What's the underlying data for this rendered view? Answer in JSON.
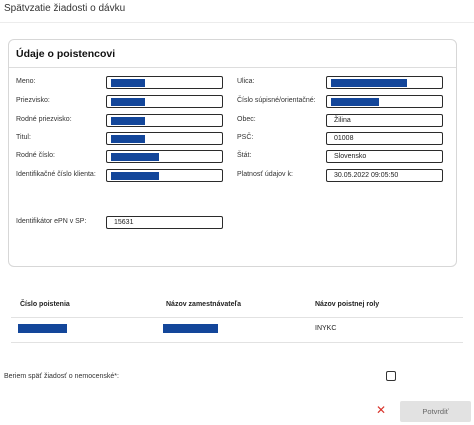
{
  "dialog": {
    "title": "Spätvzatie žiadosti o dávku"
  },
  "insured": {
    "heading": "Údaje o poistencovi",
    "fields_left": [
      {
        "label": "Meno:",
        "value": ""
      },
      {
        "label": "Priezvisko:",
        "value": ""
      },
      {
        "label": "Rodné priezvisko:",
        "value": ""
      },
      {
        "label": "Titul:",
        "value": ""
      },
      {
        "label": "Rodné číslo:",
        "value": ""
      },
      {
        "label": "Identifikačné číslo klienta:",
        "value": ""
      }
    ],
    "fields_right": [
      {
        "label": "Ulica:",
        "value": ""
      },
      {
        "label": "Číslo súpisné/orientačné:",
        "value": ""
      },
      {
        "label": "Obec:",
        "value": "Žilina"
      },
      {
        "label": "PSČ:",
        "value": "01008"
      },
      {
        "label": "Štát:",
        "value": "Slovensko"
      },
      {
        "label": "Platnosť údajov k:",
        "value": "30.05.2022 09:05:50"
      }
    ],
    "epn_label": "Identifikátor ePN v SP:",
    "epn_value": "15631"
  },
  "table": {
    "columns": [
      "Číslo poistenia",
      "Názov zamestnávateľa",
      "Názov poistnej roly"
    ],
    "rows": [
      {
        "policy_number": "",
        "employer_name": "",
        "role": "INYKC"
      }
    ]
  },
  "withdraw": {
    "label": "Beriem späť žiadosť o nemocenské*:",
    "checked": false
  },
  "actions": {
    "close_icon": "close-icon",
    "confirm_label": "Potvrdiť"
  },
  "colors": {
    "redaction": "#13469a",
    "close": "#d9332b",
    "confirm_bg": "#e2e2e2"
  }
}
